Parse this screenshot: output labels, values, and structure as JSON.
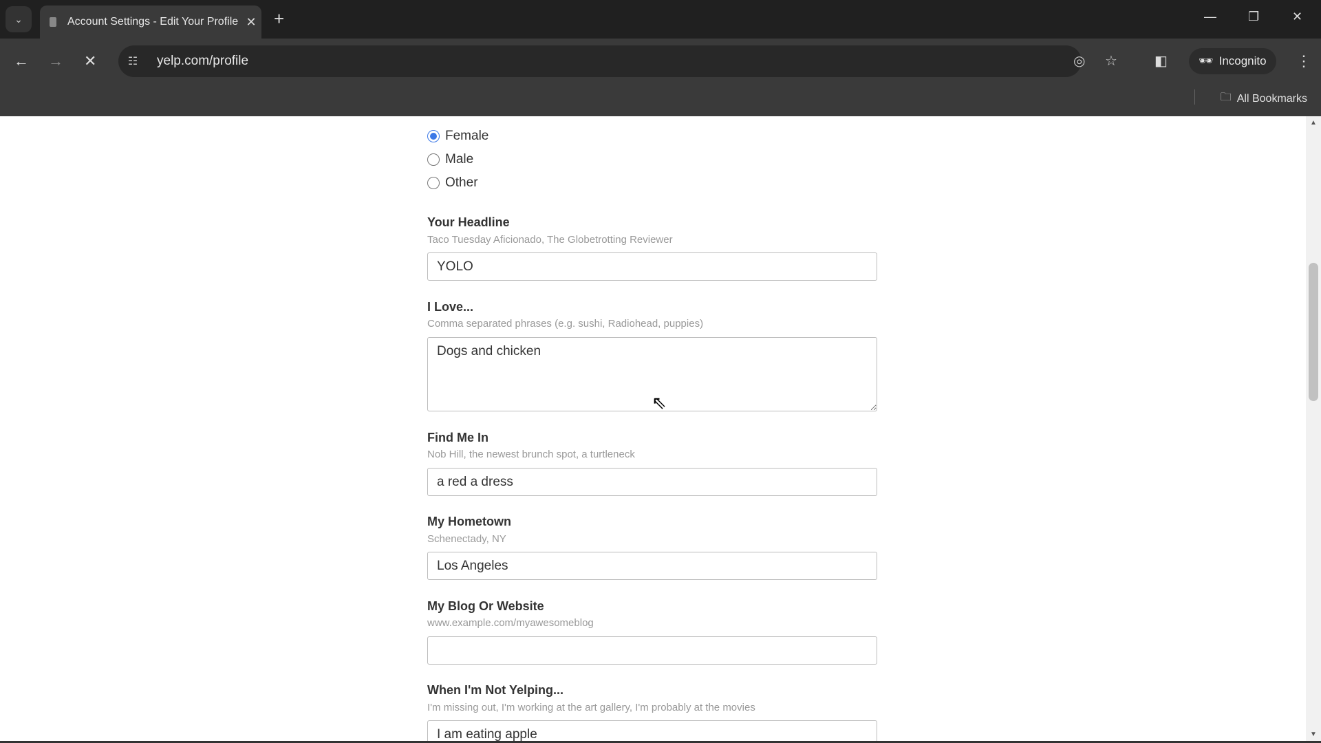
{
  "browser": {
    "tab_title": "Account Settings - Edit Your Profile",
    "url": "yelp.com/profile",
    "incognito_label": "Incognito",
    "bookmarks_label": "All Bookmarks"
  },
  "form": {
    "gender_options": [
      {
        "label": "Female",
        "checked": true
      },
      {
        "label": "Male",
        "checked": false
      },
      {
        "label": "Other",
        "checked": false
      }
    ],
    "fields": [
      {
        "label": "Your Headline",
        "hint": "Taco Tuesday Aficionado, The Globetrotting Reviewer",
        "value": "YOLO"
      },
      {
        "label": "I Love...",
        "hint": "Comma separated phrases (e.g. sushi, Radiohead, puppies)",
        "value": "Dogs and chicken"
      },
      {
        "label": "Find Me In",
        "hint": "Nob Hill, the newest brunch spot, a turtleneck",
        "value": "a red a dress"
      },
      {
        "label": "My Hometown",
        "hint": "Schenectady, NY",
        "value": "Los Angeles"
      },
      {
        "label": "My Blog Or Website",
        "hint": "www.example.com/myawesomeblog",
        "value": ""
      },
      {
        "label": "When I'm Not Yelping...",
        "hint": "I'm missing out, I'm working at the art gallery, I'm probably at the movies",
        "value": "I am eating apple"
      }
    ]
  },
  "colors": {
    "accent": "#3b78e7",
    "chrome_dark": "#202020",
    "toolbar": "#3a3a3a"
  }
}
